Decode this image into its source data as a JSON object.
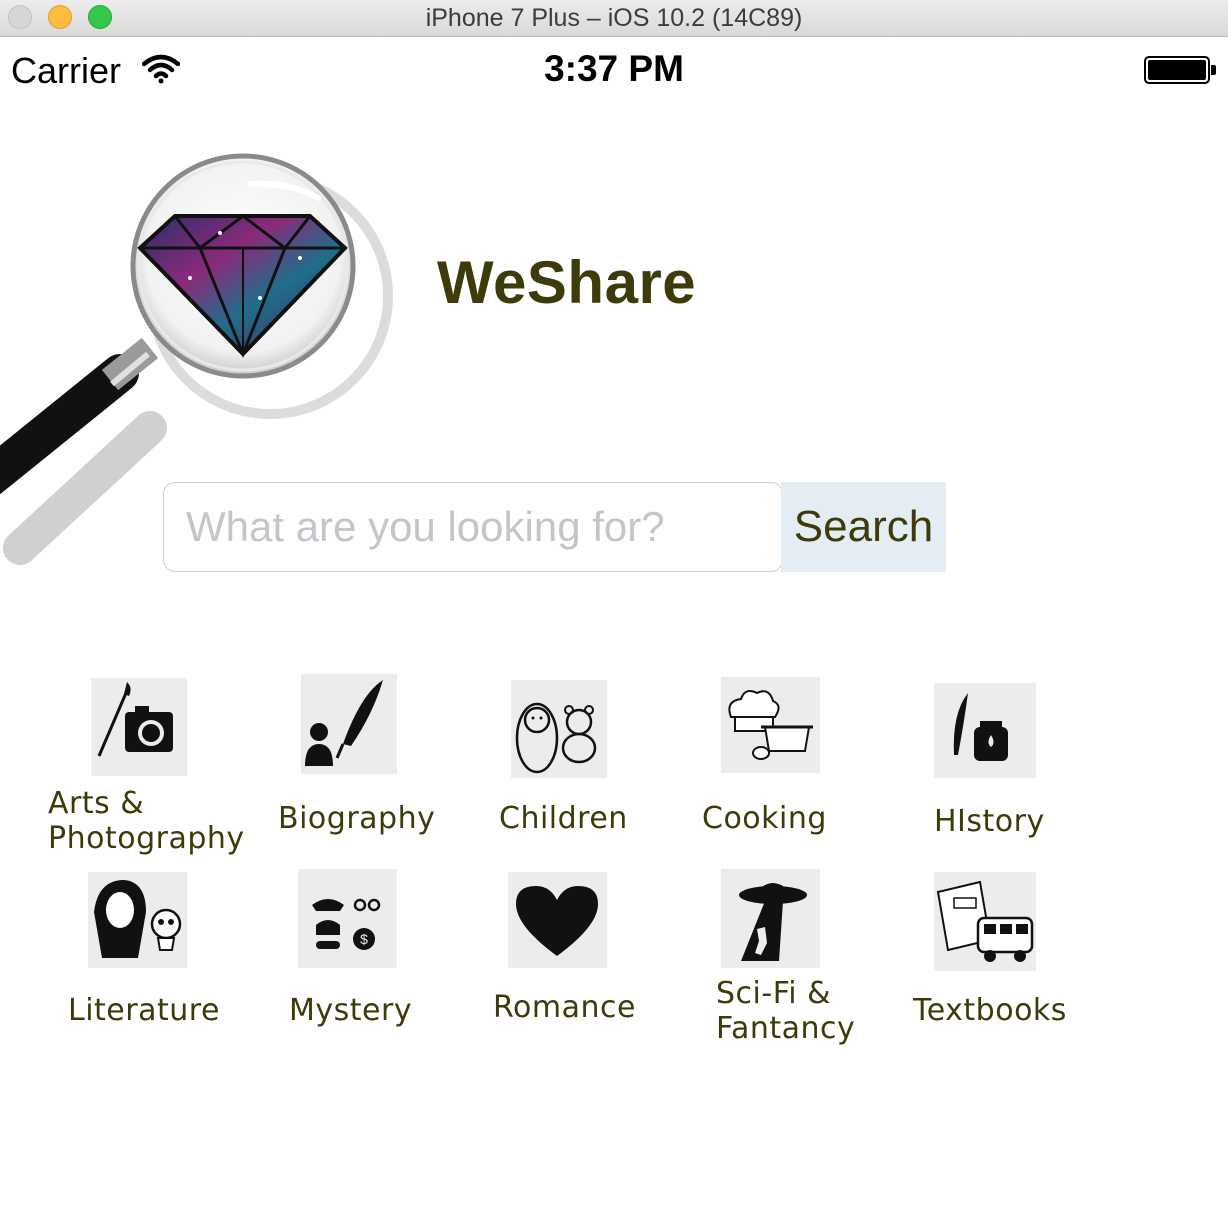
{
  "window": {
    "title": "iPhone 7 Plus – iOS 10.2 (14C89)"
  },
  "status_bar": {
    "carrier": "Carrier",
    "time": "3:37 PM"
  },
  "app": {
    "title": "WeShare"
  },
  "search": {
    "placeholder": "What are you looking for?",
    "button_label": "Search"
  },
  "categories": [
    {
      "label_line1": "Arts &",
      "label_line2": "Photography",
      "icon": "paintbrush-camera-icon"
    },
    {
      "label": "Biography",
      "icon": "quill-person-icon"
    },
    {
      "label": "Children",
      "icon": "baby-teddy-icon"
    },
    {
      "label": "Cooking",
      "icon": "chef-hat-pot-icon"
    },
    {
      "label": "HIstory",
      "icon": "quill-inkpot-icon"
    },
    {
      "label": "Literature",
      "icon": "shakespeare-skull-icon"
    },
    {
      "label": "Mystery",
      "icon": "detective-handcuffs-icon"
    },
    {
      "label": "Romance",
      "icon": "heart-icon"
    },
    {
      "label_line1": "Sci-Fi &",
      "label_line2": "Fantancy",
      "icon": "ufo-beam-icon"
    },
    {
      "label": "Textbooks",
      "icon": "math-book-school-bus-icon"
    }
  ]
}
